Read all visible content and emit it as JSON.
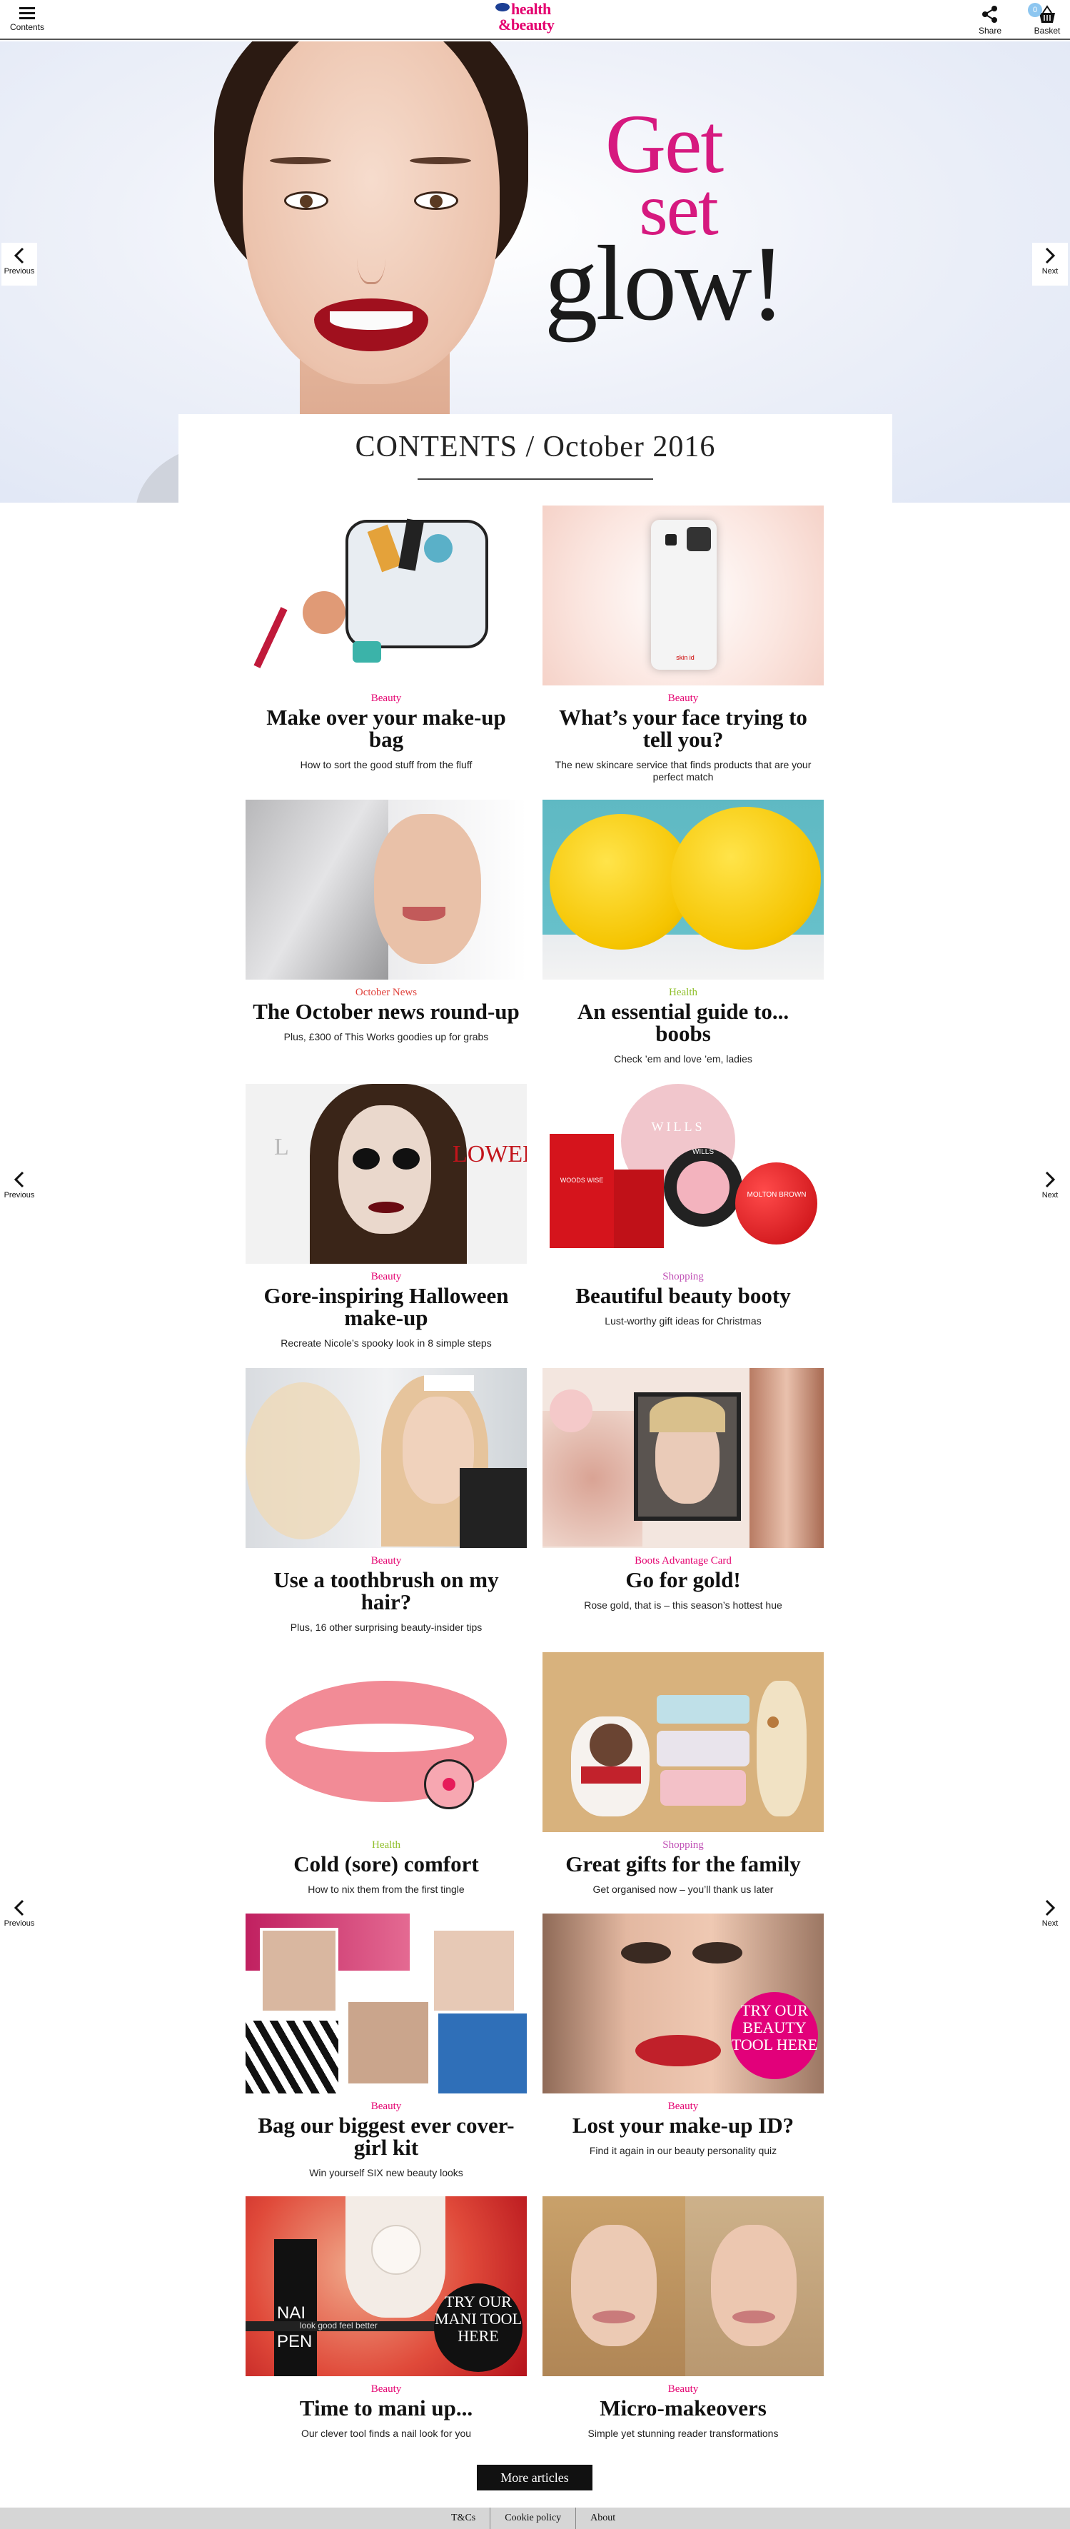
{
  "header": {
    "menu_label": "Contents",
    "logo_line1": "health",
    "logo_line2": "&beauty",
    "share_label": "Share",
    "basket_label": "Basket",
    "basket_count": "0"
  },
  "hero": {
    "headline_line1": "Get",
    "headline_line2": "set",
    "headline_line3": "glow!",
    "contents_title": "CONTENTS / October 2016"
  },
  "side_nav": {
    "previous_label": "Previous",
    "next_label": "Next"
  },
  "colors": {
    "pink": "#e4006f",
    "news_red": "#e0423c",
    "health_green": "#8fbf2a",
    "shopping_purple": "#c04fb5"
  },
  "articles": [
    {
      "category": "Beauty",
      "title": "Make over your make-up bag",
      "description": "How to sort the good stuff from the fluff"
    },
    {
      "category": "Beauty",
      "title": "What’s your face trying to tell you?",
      "description": "The new skincare service that finds products that are your perfect match"
    },
    {
      "category": "October News",
      "title": "The October news round-up",
      "description": "Plus, £300 of This Works goodies up for grabs"
    },
    {
      "category": "Health",
      "title": "An essential guide to... boobs",
      "description": "Check ’em and love ’em, ladies"
    },
    {
      "category": "Beauty",
      "title": "Gore-inspiring Halloween make-up",
      "description": "Recreate Nicole’s spooky look in 8 simple steps"
    },
    {
      "category": "Shopping",
      "title": "Beautiful beauty booty",
      "description": "Lust-worthy gift ideas for Christmas"
    },
    {
      "category": "Beauty",
      "title": "Use a toothbrush on my hair?",
      "description": "Plus, 16 other surprising beauty-insider tips"
    },
    {
      "category": "Boots Advantage Card",
      "title": "Go for gold!",
      "description": "Rose gold, that is – this season’s hottest hue"
    },
    {
      "category": "Health",
      "title": "Cold (sore) comfort",
      "description": "How to nix them from the first tingle"
    },
    {
      "category": "Shopping",
      "title": "Great gifts for the family",
      "description": "Get organised now – you’ll thank us later"
    },
    {
      "category": "Beauty",
      "title": "Bag our biggest ever cover-girl kit",
      "description": "Win yourself SIX new beauty looks"
    },
    {
      "category": "Beauty",
      "title": "Lost your make-up ID?",
      "description": "Find it again in our beauty personality quiz"
    },
    {
      "category": "Beauty",
      "title": "Time to mani up...",
      "description": "Our clever tool finds a nail look for you"
    },
    {
      "category": "Beauty",
      "title": "Micro-makeovers",
      "description": "Simple yet stunning reader transformations"
    }
  ],
  "image_text": {
    "phone_brand": "skin id",
    "halloween_sign": "LOWEEN",
    "halloween_sign2": "L",
    "gift_brand": "WILLS",
    "gift_box": "WILLS",
    "gift_perfume": "WOODS WISE",
    "ornament": "MOLTON BROWN",
    "beauty_tool_badge": "TRY OUR BEAUTY TOOL HERE",
    "mani_tool_badge": "TRY OUR MANI TOOL HERE",
    "nail_brand": "NAI",
    "nail_brand2": "PEN",
    "nail_tagline": "look good feel better"
  },
  "more_button": "More articles",
  "footer": {
    "links": [
      "T&Cs",
      "Cookie policy",
      "About"
    ]
  }
}
